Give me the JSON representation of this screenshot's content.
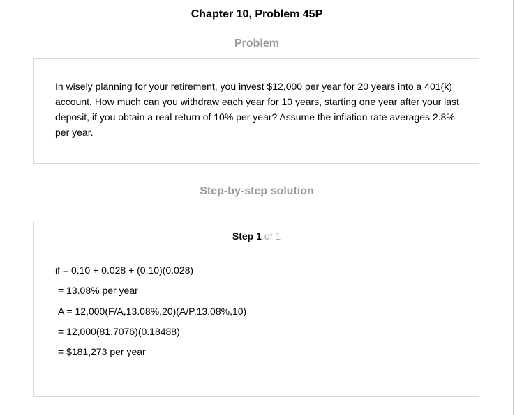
{
  "page": {
    "title": "Chapter 10, Problem 45P"
  },
  "problem": {
    "heading": "Problem",
    "text": "In wisely planning for your retirement, you invest $12,000 per year for 20 years into a 401(k) account. How much can you withdraw each year for 10 years, starting one year after your last deposit, if you obtain a real return of 10% per year? Assume the inflation rate averages 2.8% per year."
  },
  "solution": {
    "heading": "Step-by-step solution",
    "step": {
      "word": "Step",
      "number": "1",
      "of_text": "of 1"
    },
    "lines": [
      "if = 0.10 + 0.028 + (0.10)(0.028)",
      "= 13.08% per year",
      "A = 12,000(F/A,13.08%,20)(A/P,13.08%,10)",
      "= 12,000(81.7076)(0.18488)",
      "= $181,273 per year"
    ]
  }
}
